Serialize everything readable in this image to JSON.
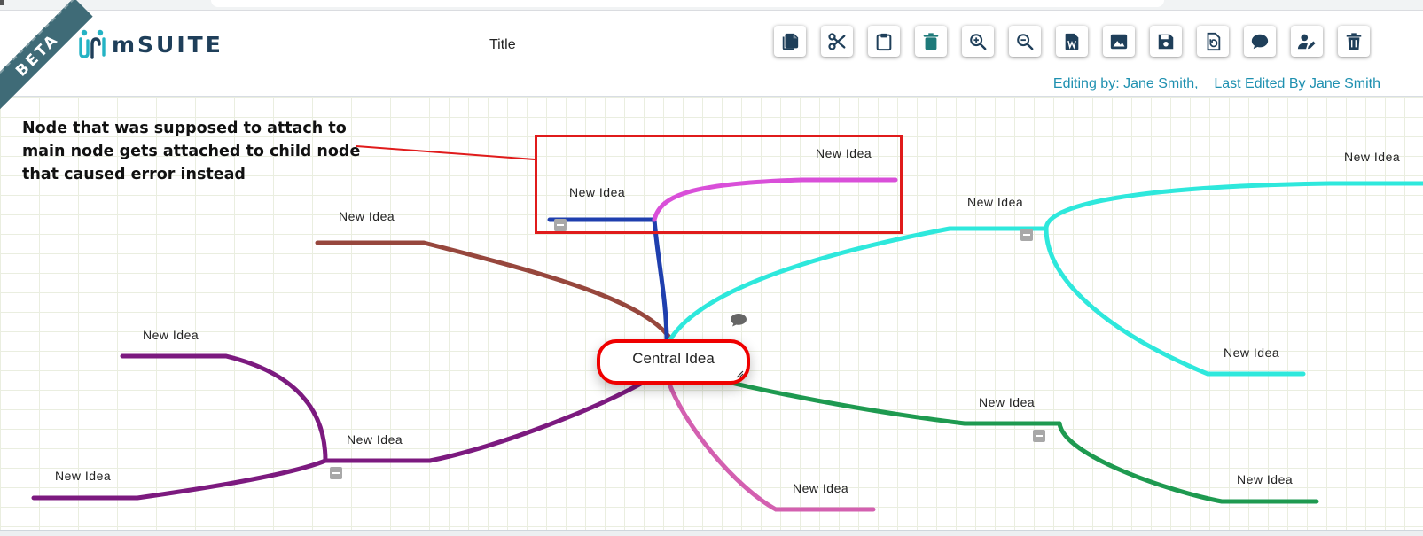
{
  "header": {
    "beta_label": "BETA",
    "logo_text": "mSUITE",
    "doc_title": "Title",
    "editing_by": "Editing by: Jane Smith,",
    "last_edited": "Last Edited By Jane Smith"
  },
  "toolbar": {
    "buttons": [
      {
        "name": "copy",
        "icon": "copy-icon"
      },
      {
        "name": "cut",
        "icon": "scissors-icon"
      },
      {
        "name": "paste",
        "icon": "clipboard-icon"
      },
      {
        "name": "delete-node",
        "icon": "trash-icon"
      },
      {
        "name": "zoom-in",
        "icon": "zoom-in-icon"
      },
      {
        "name": "zoom-out",
        "icon": "zoom-out-icon"
      },
      {
        "name": "export-word",
        "icon": "word-doc-icon"
      },
      {
        "name": "export-image",
        "icon": "image-icon"
      },
      {
        "name": "save",
        "icon": "floppy-disk-icon"
      },
      {
        "name": "history",
        "icon": "document-restore-icon"
      },
      {
        "name": "comments",
        "icon": "chat-bubble-icon"
      },
      {
        "name": "edit-user",
        "icon": "user-edit-icon"
      },
      {
        "name": "delete-map",
        "icon": "trash-can-icon"
      }
    ]
  },
  "mindmap": {
    "central_label": "Central Idea",
    "nodes": [
      {
        "id": "brown",
        "label": "New Idea",
        "color": "#97473d"
      },
      {
        "id": "blue",
        "label": "New Idea",
        "color": "#1f3fae"
      },
      {
        "id": "magenta",
        "label": "New Idea",
        "color": "#d94fd9"
      },
      {
        "id": "cyan-parent",
        "label": "New Idea",
        "color": "#2ee8dc"
      },
      {
        "id": "cyan-top",
        "label": "New Idea",
        "color": "#2ee8dc"
      },
      {
        "id": "cyan-bottom",
        "label": "New Idea",
        "color": "#2ee8dc"
      },
      {
        "id": "green-parent",
        "label": "New Idea",
        "color": "#1e9a50"
      },
      {
        "id": "green-child",
        "label": "New Idea",
        "color": "#1e9a50"
      },
      {
        "id": "pink",
        "label": "New Idea",
        "color": "#d360b0"
      },
      {
        "id": "purple-parent",
        "label": "New Idea",
        "color": "#7c1a7f"
      },
      {
        "id": "purple-top",
        "label": "New Idea",
        "color": "#7c1a7f"
      },
      {
        "id": "purple-left",
        "label": "New Idea",
        "color": "#7c1a7f"
      }
    ]
  },
  "annotation": {
    "text": "Node that was supposed to attach to main node gets attached to child node that caused error instead",
    "color": "#e01b1b"
  },
  "colors": {
    "brand": "#1f3f5a",
    "accent": "#1e90b0",
    "beta": "#3f6b77",
    "central_border": "#ef0000"
  }
}
